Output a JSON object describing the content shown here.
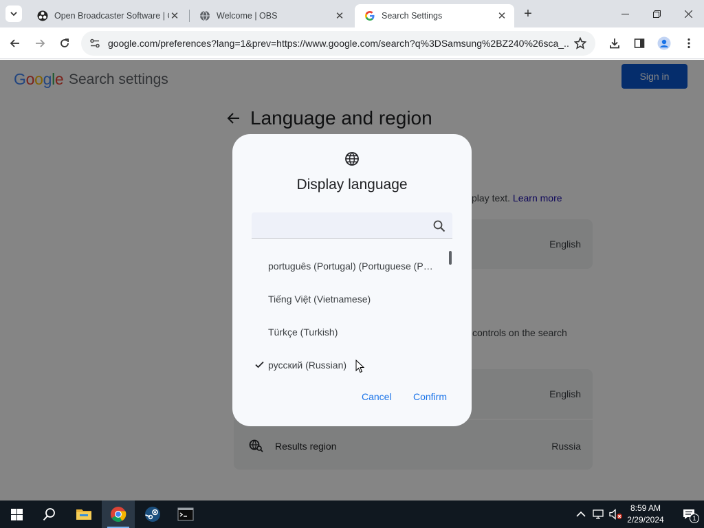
{
  "tabs": [
    {
      "title": "Open Broadcaster Software | OBS",
      "favicon": "obs-icon"
    },
    {
      "title": "Welcome | OBS",
      "favicon": "globe-icon"
    },
    {
      "title": "Search Settings",
      "favicon": "google-icon",
      "active": true
    }
  ],
  "toolbar": {
    "url": "google.com/preferences?lang=1&prev=https://www.google.com/search?q%3DSamsung%2BZ240%26sca_..."
  },
  "header": {
    "logo": "Google",
    "title": "Search settings",
    "sign_in": "Sign in"
  },
  "section": {
    "title": "Language and region",
    "desc_tail": "play text.",
    "learn_more": "Learn more",
    "desc2_tail": "controls on the search",
    "rows": [
      {
        "value": "English"
      },
      {
        "value": "English"
      },
      {
        "label": "Results region",
        "value": "Russia"
      }
    ]
  },
  "dialog": {
    "title": "Display language",
    "search_placeholder": "",
    "languages": [
      {
        "label": "português (Portugal)  (Portuguese (Portugal))",
        "selected": false
      },
      {
        "label": "Tiếng Việt  (Vietnamese)",
        "selected": false
      },
      {
        "label": "Türkçe  (Turkish)",
        "selected": false
      },
      {
        "label": "русский  (Russian)",
        "selected": true
      }
    ],
    "cancel": "Cancel",
    "confirm": "Confirm"
  },
  "taskbar": {
    "apps": [
      "start-icon",
      "search-icon",
      "file-explorer-icon",
      "chrome-icon",
      "steam-icon",
      "terminal-icon"
    ],
    "time": "8:59 AM",
    "date": "2/29/2024",
    "notification_count": "1"
  },
  "colors": {
    "accent": "#1a73e8",
    "signin_bg": "#0b57d0",
    "taskbar": "#101820"
  }
}
